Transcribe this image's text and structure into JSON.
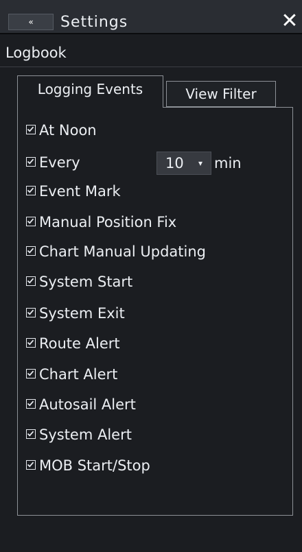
{
  "header": {
    "back_glyph": "«",
    "title": "Settings",
    "close_glyph": "✕"
  },
  "section": {
    "title": "Logbook"
  },
  "tabs": [
    {
      "label": "Logging Events",
      "active": true
    },
    {
      "label": "View Filter",
      "active": false
    }
  ],
  "events": [
    {
      "label": "At Noon",
      "checked": true
    },
    {
      "label": "Every",
      "checked": true
    },
    {
      "label": "Event Mark",
      "checked": true
    },
    {
      "label": "Manual Position Fix",
      "checked": true
    },
    {
      "label": "Chart Manual Updating",
      "checked": true
    },
    {
      "label": "System Start",
      "checked": true
    },
    {
      "label": "System Exit",
      "checked": true
    },
    {
      "label": "Route Alert",
      "checked": true
    },
    {
      "label": "Chart Alert",
      "checked": true
    },
    {
      "label": "Autosail Alert",
      "checked": true
    },
    {
      "label": "System Alert",
      "checked": true
    },
    {
      "label": "MOB Start/Stop",
      "checked": true
    }
  ],
  "interval": {
    "value": "10",
    "unit": "min",
    "arrow_glyph": "▾"
  },
  "colors": {
    "background": "#1b1d21",
    "text": "#eceff3",
    "border": "#8e9298"
  }
}
